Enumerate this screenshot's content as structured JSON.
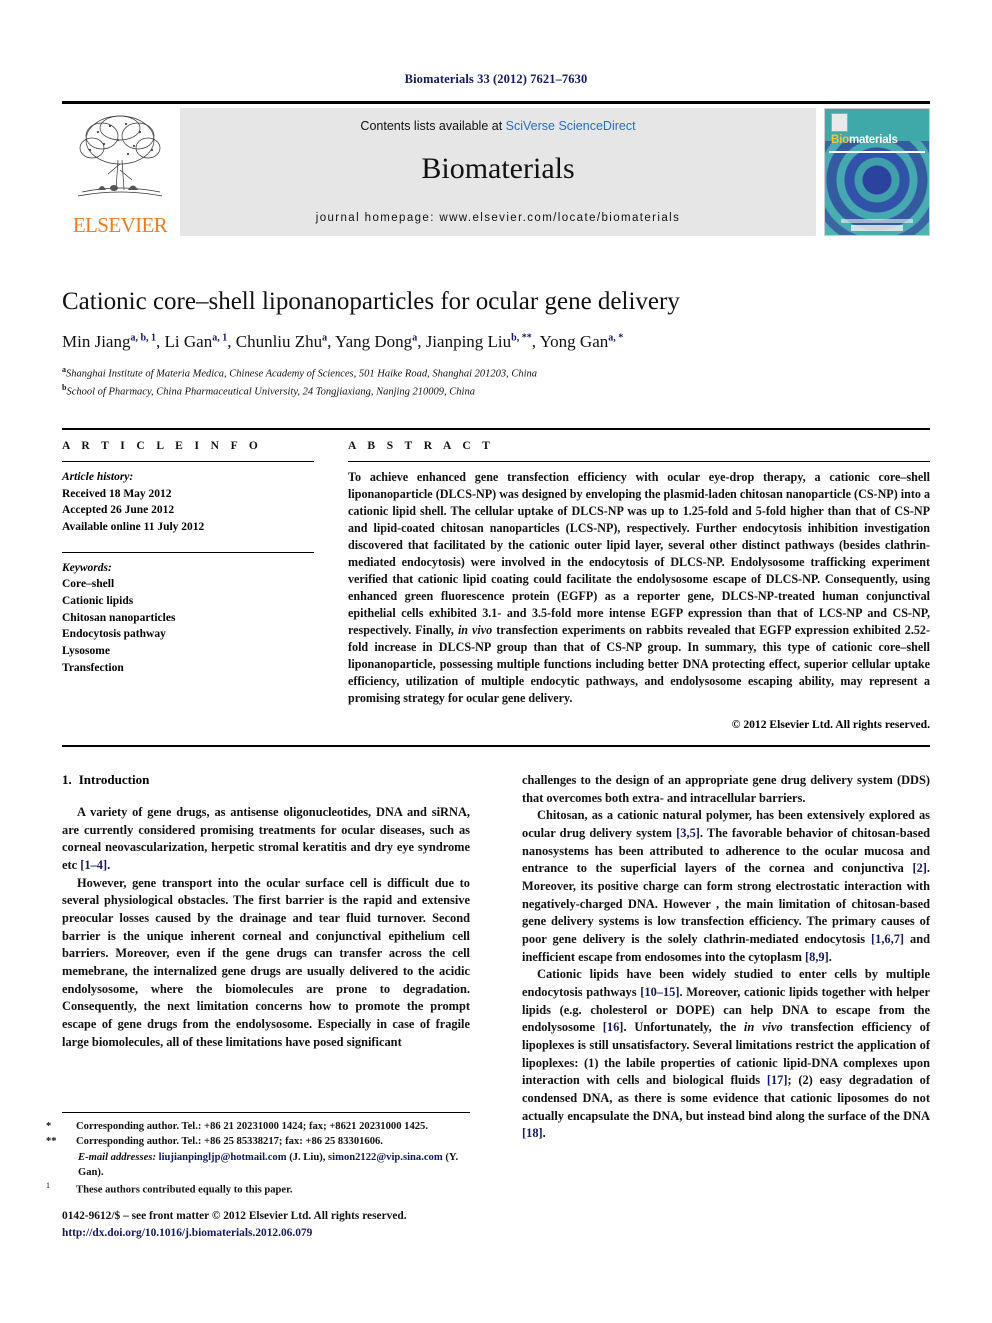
{
  "running_head": "Biomaterials 33 (2012) 7621–7630",
  "masthead": {
    "contents_prefix": "Contents lists available at ",
    "contents_link": "SciVerse ScienceDirect",
    "journal_name": "Biomaterials",
    "homepage": "journal homepage: www.elsevier.com/locate/biomaterials",
    "publisher_logo_text": "ELSEVIER",
    "cover_title_bold": "Bio",
    "cover_title_rest": "materials",
    "cover_accent_color": "#f2c73c",
    "cover_bg_color": "#3fa8a8"
  },
  "article": {
    "title": "Cationic core–shell liponanoparticles for ocular gene delivery",
    "authors": [
      {
        "name": "Min Jiang",
        "sup": "a, b, 1"
      },
      {
        "name": "Li Gan",
        "sup": "a, 1"
      },
      {
        "name": "Chunliu Zhu",
        "sup": "a"
      },
      {
        "name": "Yang Dong",
        "sup": "a"
      },
      {
        "name": "Jianping Liu",
        "sup": "b, **"
      },
      {
        "name": "Yong Gan",
        "sup": "a, *"
      }
    ],
    "affiliations": [
      {
        "mark": "a",
        "text": "Shanghai Institute of Materia Medica, Chinese Academy of Sciences, 501 Haike Road, Shanghai 201203, China"
      },
      {
        "mark": "b",
        "text": "School of Pharmacy, China Pharmaceutical University, 24 Tongjiaxiang, Nanjing 210009, China"
      }
    ]
  },
  "article_info": {
    "heading": "A R T I C L E   I N F O",
    "history_label": "Article history:",
    "history": [
      "Received 18 May 2012",
      "Accepted 26 June 2012",
      "Available online 11 July 2012"
    ],
    "keywords_label": "Keywords:",
    "keywords": [
      "Core–shell",
      "Cationic lipids",
      "Chitosan nanoparticles",
      "Endocytosis pathway",
      "Lysosome",
      "Transfection"
    ]
  },
  "abstract": {
    "heading": "A B S T R A C T",
    "paragraph_1": "To achieve enhanced gene transfection efficiency with ocular eye-drop therapy, a cationic core–shell liponanoparticle (DLCS-NP) was designed by enveloping the plasmid-laden chitosan nanoparticle (CS-NP) into a cationic lipid shell. The cellular uptake of DLCS-NP was up to 1.25-fold and 5-fold higher than that of CS-NP and lipid-coated chitosan nanoparticles (LCS-NP), respectively. Further endocytosis inhibition investigation discovered that facilitated by the cationic outer lipid layer, several other distinct pathways (besides clathrin-mediated endocytosis) were involved in the endocytosis of DLCS-NP. Endolysosome trafficking experiment verified that cationic lipid coating could facilitate the endolysosome escape of DLCS-NP. Consequently, using enhanced green fluorescence protein (EGFP) as a reporter gene, DLCS-NP-treated human conjunctival epithelial cells exhibited 3.1- and 3.5-fold more intense EGFP expression than that of LCS-NP and CS-NP, respectively. Finally, ",
    "italic_1": "in vivo",
    "paragraph_2": " transfection experiments on rabbits revealed that EGFP expression exhibited 2.52-fold increase in DLCS-NP group than that of CS-NP group. In summary, this type of cationic core–shell liponanoparticle, possessing multiple functions including better DNA protecting effect, superior cellular uptake efficiency, utilization of multiple endocytic pathways, and endolysosome escaping ability, may represent a promising strategy for ocular gene delivery.",
    "copyright": "© 2012 Elsevier Ltd. All rights reserved."
  },
  "introduction": {
    "number": "1.",
    "heading": "Introduction",
    "left_p1_a": "A variety of gene drugs, as antisense oligonucleotides, DNA and siRNA, are currently considered promising treatments for ocular diseases, such as corneal neovascularization, herpetic stromal keratitis and dry eye syndrome etc ",
    "left_p1_ref": "[1–4]",
    "left_p1_b": ".",
    "left_p2": "However, gene transport into the ocular surface cell is difficult due to several physiological obstacles. The first barrier is the rapid and extensive preocular losses caused by the drainage and tear fluid turnover. Second barrier is the unique inherent corneal and conjunctival epithelium cell barriers. Moreover, even if the gene drugs can transfer across the cell memebrane, the internalized gene drugs are usually delivered to the acidic endolysosome, where the biomolecules are prone to degradation. Consequently, the next limitation concerns how to promote the prompt escape of gene drugs from the endolysosome. Especially in case of fragile large biomolecules, all of these limitations have posed significant",
    "right_p1": "challenges to the design of an appropriate gene drug delivery system (DDS) that overcomes both extra- and intracellular barriers.",
    "right_p2_a": "Chitosan, as a cationic natural polymer, has been extensively explored as ocular drug delivery system ",
    "right_p2_ref1": "[3,5]",
    "right_p2_b": ". The favorable behavior of chitosan-based nanosystems has been attributed to adherence to the ocular mucosa and entrance to the superficial layers of the cornea and conjunctiva ",
    "right_p2_ref2": "[2]",
    "right_p2_c": ". Moreover, its positive charge can form strong electrostatic interaction with negatively-charged DNA. However , the main limitation of chitosan-based gene delivery systems is low transfection efficiency. The primary causes of poor gene delivery is the solely clathrin-mediated endocytosis ",
    "right_p2_ref3": "[1,6,7]",
    "right_p2_d": " and inefficient escape from endosomes into the cytoplasm ",
    "right_p2_ref4": "[8,9]",
    "right_p2_e": ".",
    "right_p3_a": "Cationic lipids have been widely studied to enter cells by multiple endocytosis pathways ",
    "right_p3_ref1": "[10–15]",
    "right_p3_b": ". Moreover, cationic lipids together with helper lipids (e.g. cholesterol or DOPE) can help DNA to escape from the endolysosome ",
    "right_p3_ref2": "[16]",
    "right_p3_c": ". Unfortunately, the ",
    "right_p3_italic": "in vivo",
    "right_p3_d": " transfection efficiency of lipoplexes is still unsatisfactory. Several limitations restrict the application of lipoplexes: (1) the labile properties of cationic lipid-DNA complexes upon interaction with cells and biological fluids ",
    "right_p3_ref3": "[17]",
    "right_p3_e": "; (2) easy degradation of condensed DNA, as there is some evidence that cationic liposomes do not actually encapsulate the DNA, but instead bind along the surface of the DNA ",
    "right_p3_ref4": "[18]",
    "right_p3_f": "."
  },
  "footnotes": {
    "corr1_mark": "*",
    "corr1": "Corresponding author. Tel.: +86 21 20231000 1424; fax; +8621 20231000 1425.",
    "corr2_mark": "**",
    "corr2": "Corresponding author. Tel.: +86 25 85338217; fax: +86 25 83301606.",
    "email_label": "E-mail addresses:",
    "email1": "liujianpingljp@hotmail.com",
    "email1_owner": "(J. Liu)",
    "email2": "simon2122@vip.sina.com",
    "email2_owner": "(Y. Gan)",
    "equal_mark": "1",
    "equal_contrib": "These authors contributed equally to this paper."
  },
  "imprint": {
    "line1": "0142-9612/$ – see front matter © 2012 Elsevier Ltd. All rights reserved.",
    "doi": "http://dx.doi.org/10.1016/j.biomaterials.2012.06.079"
  }
}
